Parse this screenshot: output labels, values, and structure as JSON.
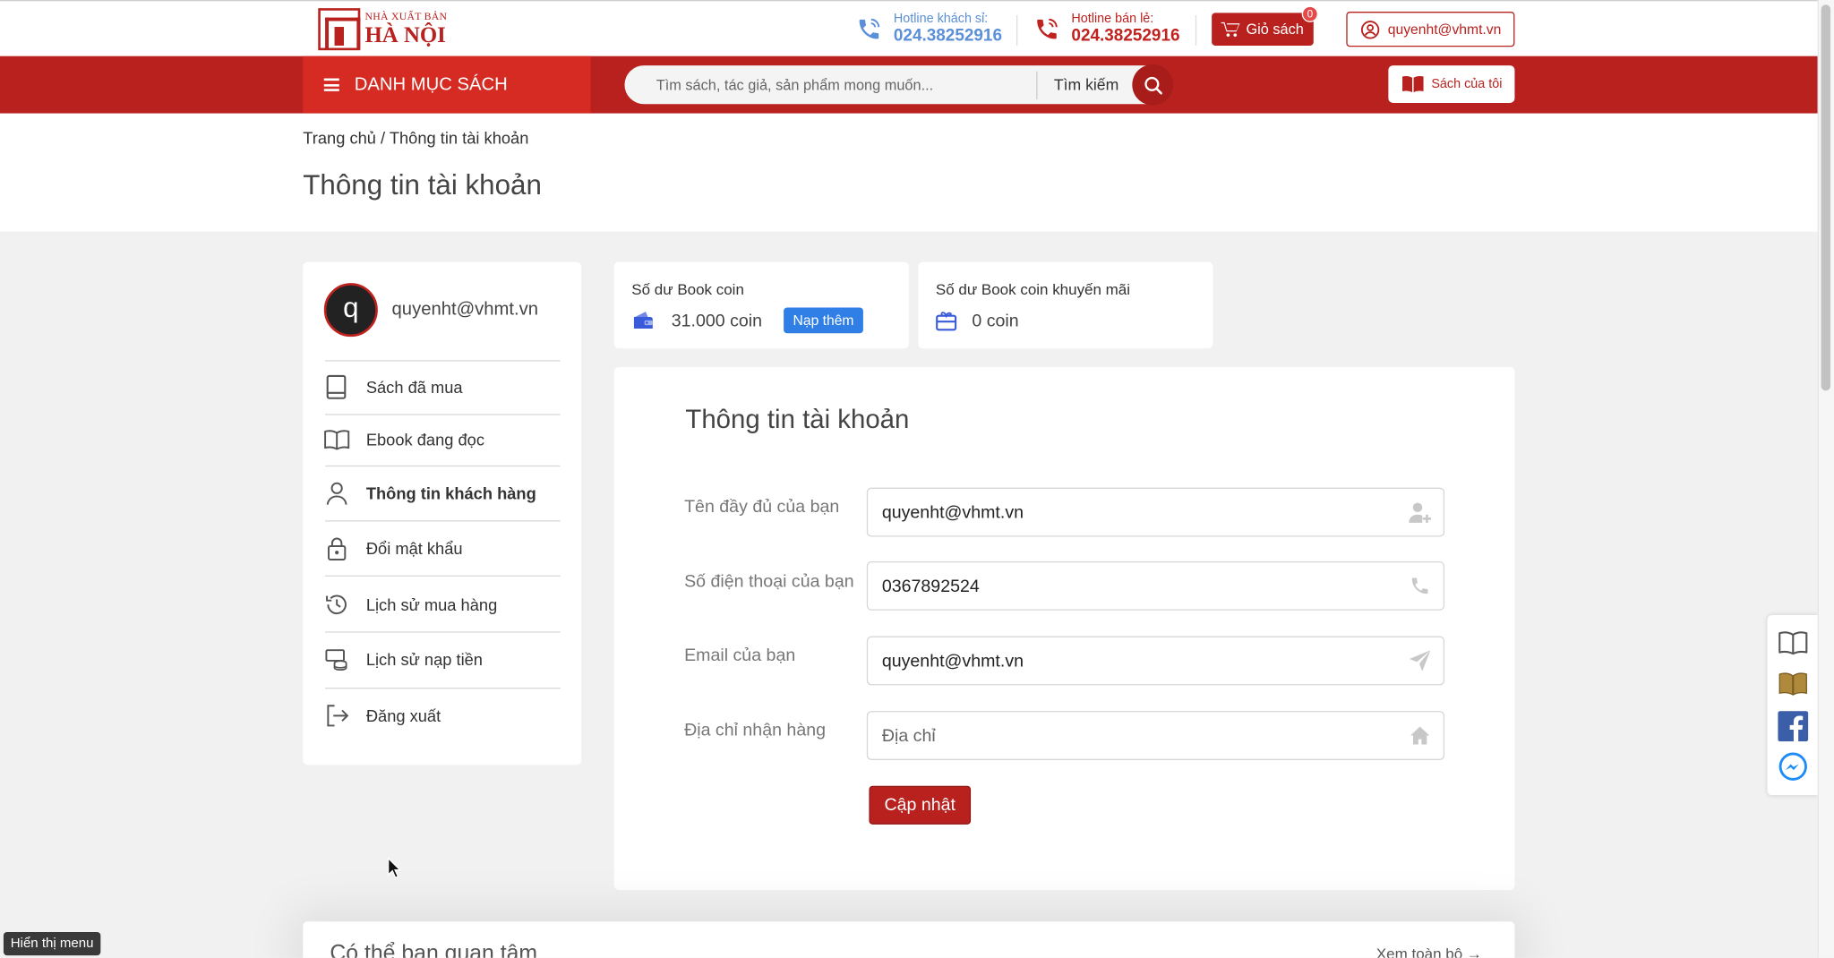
{
  "header": {
    "logo_small": "NHÀ XUẤT BẢN",
    "logo_big": "HÀ NỘI",
    "hotline_wholesale_label": "Hotline khách sỉ:",
    "hotline_wholesale_number": "024.38252916",
    "hotline_retail_label": "Hotline bán lẻ:",
    "hotline_retail_number": "024.38252916",
    "cart_label": "Giỏ sách",
    "cart_count": "0",
    "account_label": "quyenht@vhmt.vn"
  },
  "nav": {
    "category_label": "DANH MỤC SÁCH",
    "search_placeholder": "Tìm sách, tác giả, sản phẩm mong muốn...",
    "search_label": "Tìm kiếm",
    "my_books_label": "Sách của tôi"
  },
  "page": {
    "breadcrumb": "Trang chủ / Thông tin tài khoản",
    "title": "Thông tin tài khoản"
  },
  "sidebar": {
    "avatar_letter": "q",
    "user_email": "quyenht@vhmt.vn",
    "items": [
      {
        "label": "Sách đã mua",
        "icon": "book-icon"
      },
      {
        "label": "Ebook đang đọc",
        "icon": "open-book-icon"
      },
      {
        "label": "Thông tin khách hàng",
        "icon": "user-icon",
        "active": true
      },
      {
        "label": "Đổi mật khẩu",
        "icon": "lock-icon"
      },
      {
        "label": "Lịch sử mua hàng",
        "icon": "history-icon"
      },
      {
        "label": "Lịch sử nạp tiền",
        "icon": "coins-icon"
      },
      {
        "label": "Đăng xuất",
        "icon": "logout-icon"
      }
    ]
  },
  "coins": {
    "balance_title": "Số dư Book coin",
    "balance_value": "31.000 coin",
    "topup_label": "Nạp thêm",
    "promo_title": "Số dư Book coin khuyến mãi",
    "promo_value": "0 coin"
  },
  "form": {
    "title": "Thông tin tài khoản",
    "name_label": "Tên đầy đủ của bạn",
    "name_value": "quyenht@vhmt.vn",
    "phone_label": "Số điện thoại của bạn",
    "phone_value": "0367892524",
    "email_label": "Email của bạn",
    "email_value": "quyenht@vhmt.vn",
    "address_label": "Địa chỉ nhận hàng",
    "address_value": "",
    "address_placeholder": "Địa chỉ",
    "submit_label": "Cập nhật"
  },
  "recommendations": {
    "title": "Có thể bạn quan tâm",
    "see_all": "Xem toàn bộ"
  },
  "status_tip": "Hiển thị menu",
  "colors": {
    "brand_red": "#b8211e",
    "category_red": "#d52b22",
    "topup_blue": "#2f7fe6",
    "hotline_blue": "#5b8fd8"
  }
}
